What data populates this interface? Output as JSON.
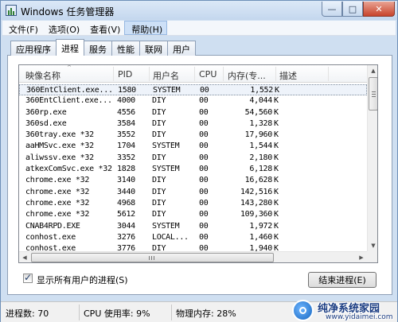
{
  "window": {
    "title": "Windows 任务管理器",
    "controls": {
      "minimize": "—",
      "maximize": "□",
      "close": "✕"
    }
  },
  "menu": [
    "文件(F)",
    "选项(O)",
    "查看(V)",
    "帮助(H)"
  ],
  "tabs": [
    "应用程序",
    "进程",
    "服务",
    "性能",
    "联网",
    "用户"
  ],
  "selected_tab": "进程",
  "list": {
    "columns": [
      "映像名称",
      "PID",
      "用户名",
      "CPU",
      "内存(专...",
      "描述"
    ],
    "rows": [
      {
        "image": "360EntClient.exe...",
        "pid": "1580",
        "user": "SYSTEM",
        "cpu": "00",
        "mem": "1,552",
        "unit": "K"
      },
      {
        "image": "360EntClient.exe...",
        "pid": "4000",
        "user": "DIY",
        "cpu": "00",
        "mem": "4,044",
        "unit": "K"
      },
      {
        "image": "360rp.exe",
        "pid": "4556",
        "user": "DIY",
        "cpu": "00",
        "mem": "54,560",
        "unit": "K"
      },
      {
        "image": "360sd.exe",
        "pid": "3584",
        "user": "DIY",
        "cpu": "00",
        "mem": "1,328",
        "unit": "K"
      },
      {
        "image": "360tray.exe *32",
        "pid": "3552",
        "user": "DIY",
        "cpu": "00",
        "mem": "17,960",
        "unit": "K"
      },
      {
        "image": "aaHMSvc.exe *32",
        "pid": "1704",
        "user": "SYSTEM",
        "cpu": "00",
        "mem": "1,544",
        "unit": "K"
      },
      {
        "image": "aliwssv.exe *32",
        "pid": "3352",
        "user": "DIY",
        "cpu": "00",
        "mem": "2,180",
        "unit": "K"
      },
      {
        "image": "atkexComSvc.exe *32",
        "pid": "1828",
        "user": "SYSTEM",
        "cpu": "00",
        "mem": "6,128",
        "unit": "K"
      },
      {
        "image": "chrome.exe *32",
        "pid": "3140",
        "user": "DIY",
        "cpu": "00",
        "mem": "16,628",
        "unit": "K"
      },
      {
        "image": "chrome.exe *32",
        "pid": "3440",
        "user": "DIY",
        "cpu": "00",
        "mem": "142,516",
        "unit": "K"
      },
      {
        "image": "chrome.exe *32",
        "pid": "4968",
        "user": "DIY",
        "cpu": "00",
        "mem": "143,280",
        "unit": "K"
      },
      {
        "image": "chrome.exe *32",
        "pid": "5612",
        "user": "DIY",
        "cpu": "00",
        "mem": "109,360",
        "unit": "K"
      },
      {
        "image": "CNAB4RPD.EXE",
        "pid": "3044",
        "user": "SYSTEM",
        "cpu": "00",
        "mem": "1,972",
        "unit": "K"
      },
      {
        "image": "conhost.exe",
        "pid": "3276",
        "user": "LOCAL...",
        "cpu": "00",
        "mem": "1,460",
        "unit": "K"
      },
      {
        "image": "conhost.exe",
        "pid": "3776",
        "user": "DIY",
        "cpu": "00",
        "mem": "1,940",
        "unit": "K"
      }
    ],
    "scroll": {
      "up": "▲",
      "down": "▼",
      "left": "◀",
      "right": "▶"
    },
    "sort_indicator": "^"
  },
  "show_all_users": {
    "label": "显示所有用户的进程(S)",
    "checked": true,
    "mark": "✓"
  },
  "end_process_button": "结束进程(E)",
  "status": {
    "processes": "进程数: 70",
    "cpu": "CPU 使用率: 9%",
    "memory": "物理内存: 28%"
  },
  "watermark": {
    "name": "纯净系统家园",
    "url": "www.yidaimei.com"
  }
}
